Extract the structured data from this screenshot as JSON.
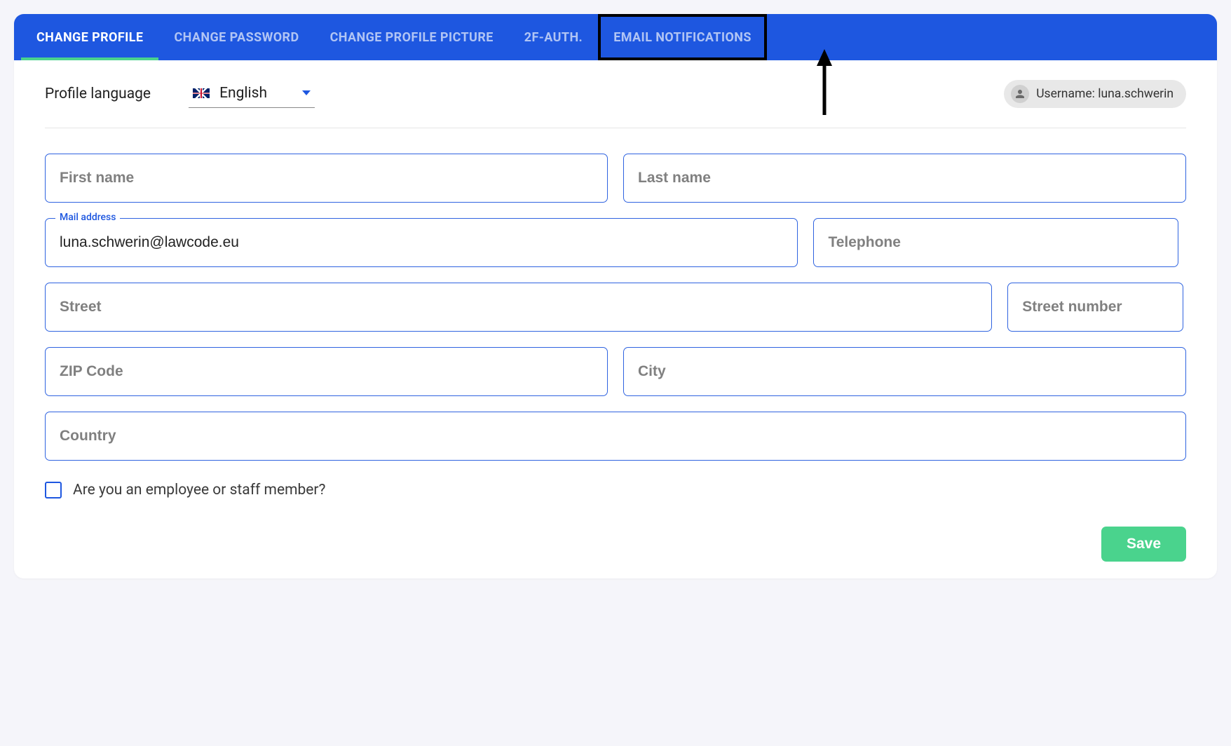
{
  "tabs": [
    {
      "label": "CHANGE PROFILE",
      "active": true
    },
    {
      "label": "CHANGE PASSWORD",
      "active": false
    },
    {
      "label": "CHANGE PROFILE PICTURE",
      "active": false
    },
    {
      "label": "2F-AUTH.",
      "active": false
    },
    {
      "label": "EMAIL NOTIFICATIONS",
      "active": false,
      "highlighted": true
    }
  ],
  "language": {
    "label": "Profile language",
    "selected": "English"
  },
  "user": {
    "badge_prefix": "Username: ",
    "username": "luna.schwerin"
  },
  "fields": {
    "first_name": {
      "placeholder": "First name",
      "value": ""
    },
    "last_name": {
      "placeholder": "Last name",
      "value": ""
    },
    "mail": {
      "legend": "Mail address",
      "value": "luna.schwerin@lawcode.eu"
    },
    "telephone": {
      "placeholder": "Telephone",
      "value": ""
    },
    "street": {
      "placeholder": "Street",
      "value": ""
    },
    "street_number": {
      "placeholder": "Street number",
      "value": ""
    },
    "zip": {
      "placeholder": "ZIP Code",
      "value": ""
    },
    "city": {
      "placeholder": "City",
      "value": ""
    },
    "country": {
      "placeholder": "Country",
      "value": ""
    }
  },
  "checkbox": {
    "label": "Are you an employee or staff member?",
    "checked": false
  },
  "actions": {
    "save": "Save"
  }
}
